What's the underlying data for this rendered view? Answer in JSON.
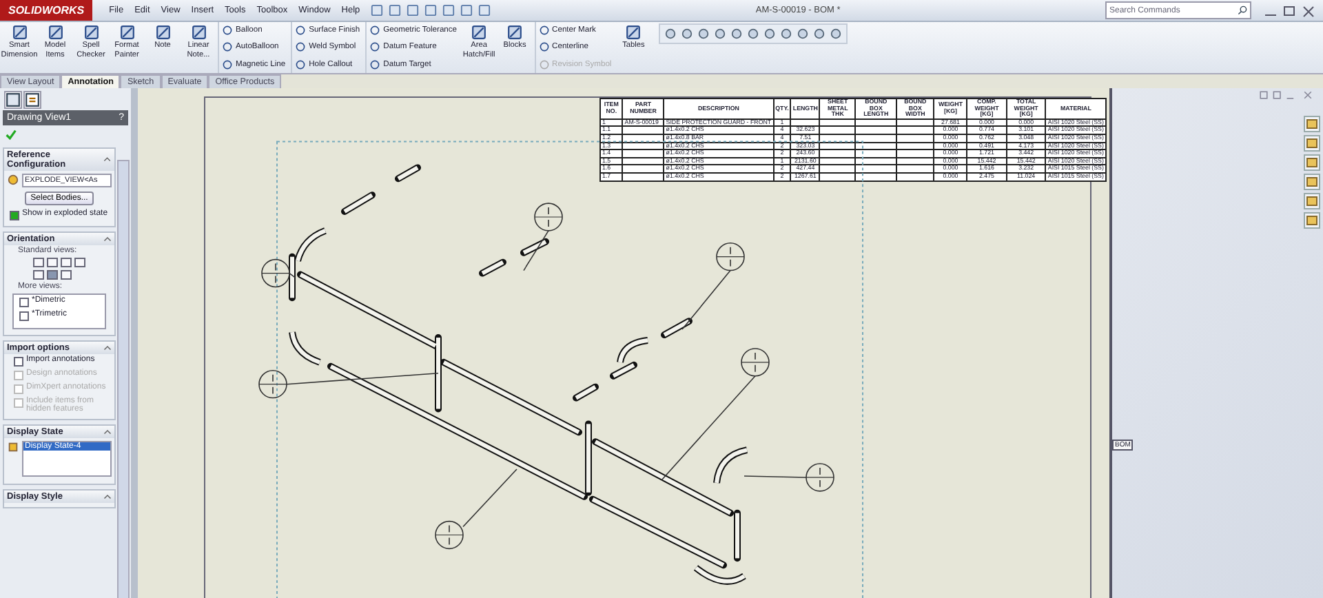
{
  "window": {
    "app": "SOLIDWORKS",
    "title": "AM-S-00019 - BOM *",
    "search": {
      "placeholder": "Search Commands"
    }
  },
  "menu": [
    "File",
    "Edit",
    "View",
    "Insert",
    "Tools",
    "Toolbox",
    "Window",
    "Help"
  ],
  "ribbon": [
    {
      "kind": "large",
      "label": "Smart Dimension"
    },
    {
      "kind": "large",
      "label": "Model Items"
    },
    {
      "kind": "large",
      "label": "Spell Checker"
    },
    {
      "kind": "large",
      "label": "Format Painter"
    },
    {
      "kind": "large",
      "label": "Note"
    },
    {
      "kind": "large",
      "label": "Linear Note..."
    },
    {
      "kind": "column",
      "items": [
        {
          "label": "Balloon",
          "disabled": false
        },
        {
          "label": "AutoBalloon",
          "disabled": false
        },
        {
          "label": "Magnetic Line",
          "disabled": false
        }
      ]
    },
    {
      "kind": "column",
      "items": [
        {
          "label": "Surface Finish",
          "disabled": false
        },
        {
          "label": "Weld Symbol",
          "disabled": false
        },
        {
          "label": "Hole Callout",
          "disabled": false
        }
      ]
    },
    {
      "kind": "column",
      "items": [
        {
          "label": "Geometric Tolerance",
          "disabled": false
        },
        {
          "label": "Datum Feature",
          "disabled": false
        },
        {
          "label": "Datum Target",
          "disabled": false
        }
      ]
    },
    {
      "kind": "large",
      "label": "Area Hatch/Fill"
    },
    {
      "kind": "large",
      "label": "Blocks"
    },
    {
      "kind": "column",
      "items": [
        {
          "label": "Center Mark",
          "disabled": false
        },
        {
          "label": "Centerline",
          "disabled": false
        },
        {
          "label": "Revision Symbol",
          "disabled": true
        }
      ]
    },
    {
      "kind": "large",
      "label": "Tables"
    }
  ],
  "tabs": [
    {
      "label": "View Layout",
      "selected": false
    },
    {
      "label": "Annotation",
      "selected": true
    },
    {
      "label": "Sketch",
      "selected": false
    },
    {
      "label": "Evaluate",
      "selected": false
    },
    {
      "label": "Office Products",
      "selected": false
    }
  ],
  "panel": {
    "title": "Drawing View1",
    "help": "?",
    "reference_configuration": {
      "heading": "Reference Configuration",
      "value": "EXPLODE_VIEW<As",
      "button": "Select Bodies...",
      "checkbox": {
        "label": "Show in exploded state",
        "checked": true
      }
    },
    "orientation": {
      "heading": "Orientation",
      "standard_label": "Standard views:",
      "views": [
        {
          "selected": false
        },
        {
          "selected": false
        },
        {
          "selected": false
        },
        {
          "selected": false
        },
        {
          "selected": false
        },
        {
          "selected": true
        },
        {
          "selected": false
        }
      ],
      "more_label": "More views:",
      "more_views": [
        {
          "label": "*Dimetric",
          "checked": false
        },
        {
          "label": "*Trimetric",
          "checked": false
        }
      ]
    },
    "import_options": {
      "heading": "Import options",
      "options": [
        {
          "label": "Import annotations",
          "checked": false,
          "disabled": false
        },
        {
          "label": "Design annotations",
          "checked": false,
          "disabled": true
        },
        {
          "label": "DimXpert annotations",
          "checked": false,
          "disabled": true
        },
        {
          "label": "Include items from hidden features",
          "checked": false,
          "disabled": true
        }
      ]
    },
    "display_state": {
      "heading": "Display State",
      "items": [
        {
          "label": "Display State-4",
          "selected": true
        }
      ]
    },
    "display_style": {
      "heading": "Display Style"
    }
  },
  "bom": {
    "columns": [
      "ITEM NO.",
      "PART NUMBER",
      "DESCRIPTION",
      "QTY.",
      "LENGTH",
      "SHEET METAL THK",
      "BOUND BOX LENGTH",
      "BOUND BOX WIDTH",
      "WEIGHT [KG]",
      "COMP. WEIGHT [KG]",
      "TOTAL WEIGHT [KG]",
      "MATERIAL"
    ],
    "rows": [
      [
        "1",
        "AM-S-00019",
        "SIDE PROTECTION GUARD - FRONT",
        "1",
        "",
        "",
        "",
        "",
        "27.681",
        "0.000",
        "0.000",
        "AISI 1020 Steel (SS)"
      ],
      [
        "1.1",
        "",
        "ø1.4x0.2 CHS",
        "4",
        "32.623",
        "",
        "",
        "",
        "0.000",
        "0.774",
        "3.101",
        "AISI 1020 Steel (SS)"
      ],
      [
        "1.2",
        "",
        "ø1.4x0.8 BAR",
        "4",
        "7.51",
        "",
        "",
        "",
        "0.000",
        "0.762",
        "3.048",
        "AISI 1020 Steel (SS)"
      ],
      [
        "1.3",
        "",
        "ø1.4x0.2 CHS",
        "2",
        "323.03",
        "",
        "",
        "",
        "0.000",
        "0.491",
        "4.173",
        "AISI 1020 Steel (SS)"
      ],
      [
        "1.4",
        "",
        "ø1.4x0.2 CHS",
        "2",
        "243.60",
        "",
        "",
        "",
        "0.000",
        "1.721",
        "3.442",
        "AISI 1020 Steel (SS)"
      ],
      [
        "1.5",
        "",
        "ø1.4x0.2 CHS",
        "1",
        "2131.60",
        "",
        "",
        "",
        "0.000",
        "15.442",
        "15.442",
        "AISI 1020 Steel (SS)"
      ],
      [
        "1.6",
        "",
        "ø1.4x0.2 CHS",
        "2",
        "427.44",
        "",
        "",
        "",
        "0.000",
        "1.616",
        "3.232",
        "AISI 1015 Steel (SS)"
      ],
      [
        "1.7",
        "",
        "ø1.4x0.2 CHS",
        "2",
        "1267.61",
        "",
        "",
        "",
        "0.000",
        "2.475",
        "11.024",
        "AISI 1015 Steel (SS)"
      ]
    ]
  },
  "sheet_tab": "BOM"
}
